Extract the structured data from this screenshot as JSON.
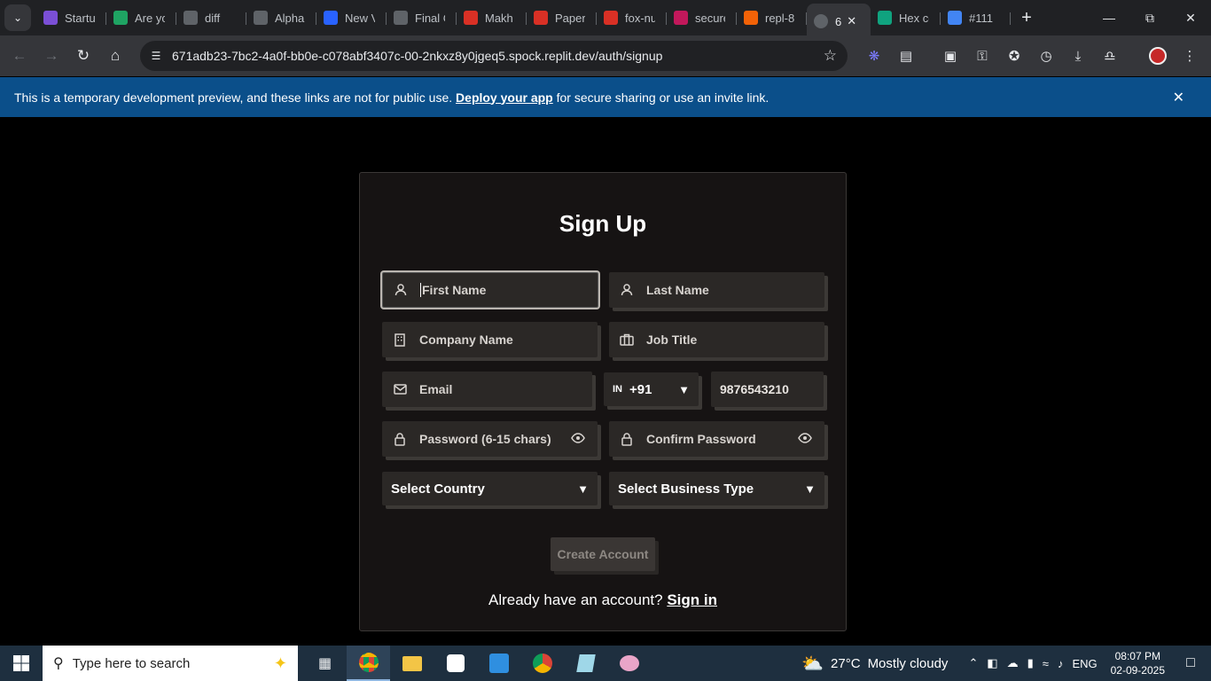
{
  "browser": {
    "tabs": [
      {
        "title": "Startu",
        "icon": "app-icon",
        "color": "#7b4fd6"
      },
      {
        "title": "Are yo",
        "icon": "sheets-icon",
        "color": "#1fa463"
      },
      {
        "title": "diff",
        "icon": "globe-icon",
        "color": "#5f6368"
      },
      {
        "title": "Alpha",
        "icon": "globe-icon",
        "color": "#5f6368"
      },
      {
        "title": "New V",
        "icon": "pen-icon",
        "color": "#2962ff"
      },
      {
        "title": "Final C",
        "icon": "globe-icon",
        "color": "#5f6368"
      },
      {
        "title": "Makh",
        "icon": "gmail-icon",
        "color": "#d93025"
      },
      {
        "title": "Paper",
        "icon": "gmail-icon",
        "color": "#d93025"
      },
      {
        "title": "fox-nu",
        "icon": "gmail-icon",
        "color": "#d93025"
      },
      {
        "title": "secure",
        "icon": "heart-icon",
        "color": "#c2185b"
      },
      {
        "title": "repl-8",
        "icon": "replit-icon",
        "color": "#f26207"
      }
    ],
    "active_tab": {
      "title": "6",
      "close": "✕"
    },
    "tabs_after": [
      {
        "title": "Hex cc",
        "icon": "openai-icon",
        "color": "#10a37f"
      },
      {
        "title": "#111",
        "icon": "google-icon",
        "color": "#4285f4"
      }
    ],
    "new_tab": "+",
    "url": "671adb23-7bc2-4a0f-bb0e-c078abf3407c-00-2nkxz8y0jgeq5.spock.replit.dev/auth/signup"
  },
  "banner": {
    "text_before": "This is a temporary development preview, and these links are not for public use. ",
    "link": "Deploy your app",
    "text_after": " for secure sharing or use an invite link.",
    "close": "✕"
  },
  "form": {
    "title": "Sign Up",
    "first_name": "First Name",
    "last_name": "Last Name",
    "company_name": "Company Name",
    "job_title": "Job Title",
    "email": "Email",
    "country_flag": "IN",
    "country_code": "+91",
    "phone_value": "9876543210",
    "password": "Password (6-15 chars)",
    "confirm_password": "Confirm Password",
    "select_country": "Select Country",
    "select_business_type": "Select Business Type",
    "create_button": "Create Account",
    "signin_prompt": "Already have an account? ",
    "signin_link": "Sign in"
  },
  "taskbar": {
    "search_placeholder": "Type here to search",
    "weather_temp": "27°C",
    "weather_desc": "Mostly cloudy",
    "lang": "ENG",
    "time": "08:07 PM",
    "date": "02-09-2025"
  }
}
